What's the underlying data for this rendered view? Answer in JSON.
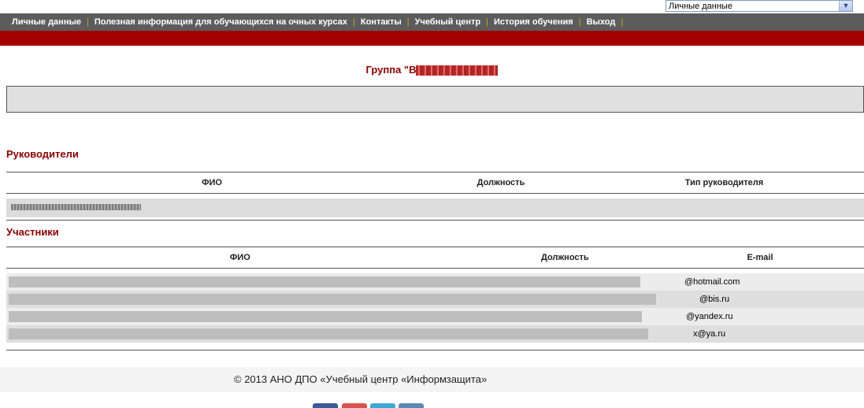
{
  "top_select": {
    "value": "Личные данные"
  },
  "nav": {
    "items": [
      "Личные данные",
      "Полезная информация для обучающихся на очных курсах",
      "Контакты",
      "Учебный центр",
      "История обучения",
      "Выход"
    ]
  },
  "group": {
    "title": "Группа \"В"
  },
  "leaders": {
    "title": "Руководители",
    "headers": [
      "ФИО",
      "Должность",
      "Тип руководителя"
    ]
  },
  "members": {
    "title": "Участники",
    "headers": [
      "ФИО",
      "Должность",
      "E-mail"
    ],
    "emails": [
      "@hotmail.com",
      "@bis.ru",
      "@yandex.ru",
      "x@ya.ru"
    ]
  },
  "footer": {
    "copyright": "© 2013 АНО ДПО «Учебный центр «Информзащита»"
  },
  "colors": {
    "accent": "#a50000",
    "title": "#8b0000",
    "navbar": "#5c5c5c"
  }
}
